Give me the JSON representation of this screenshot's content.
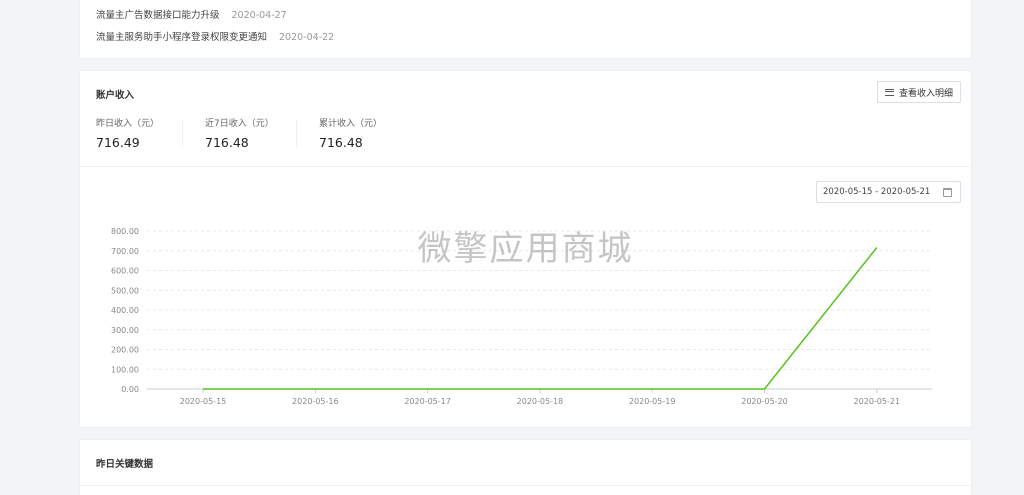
{
  "notices": [
    {
      "title": "流量主广告数据接口能力升级",
      "date": "2020-04-27"
    },
    {
      "title": "流量主服务助手小程序登录权限变更通知",
      "date": "2020-04-22"
    }
  ],
  "income": {
    "title": "账户收入",
    "detail_button": "查看收入明细",
    "stats": [
      {
        "label": "昨日收入（元）",
        "value": "716.49"
      },
      {
        "label": "近7日收入（元）",
        "value": "716.48"
      },
      {
        "label": "累计收入（元）",
        "value": "716.48"
      }
    ],
    "date_range": "2020-05-15 - 2020-05-21",
    "watermark": "微擎应用商城"
  },
  "key_data": {
    "title": "昨日关键数据"
  },
  "colors": {
    "line": "#52c41a",
    "grid": "#e8e8e8",
    "axis_text": "#888888"
  },
  "chart_data": {
    "type": "line",
    "x": [
      "2020-05-15",
      "2020-05-16",
      "2020-05-17",
      "2020-05-18",
      "2020-05-19",
      "2020-05-20",
      "2020-05-21"
    ],
    "series": [
      {
        "values": [
          0,
          0,
          0,
          0,
          0,
          0,
          716.48
        ]
      }
    ],
    "ylim": [
      0,
      800
    ],
    "yticks": [
      "0.00",
      "100.00",
      "200.00",
      "300.00",
      "400.00",
      "500.00",
      "600.00",
      "700.00",
      "800.00"
    ],
    "grid": true
  }
}
